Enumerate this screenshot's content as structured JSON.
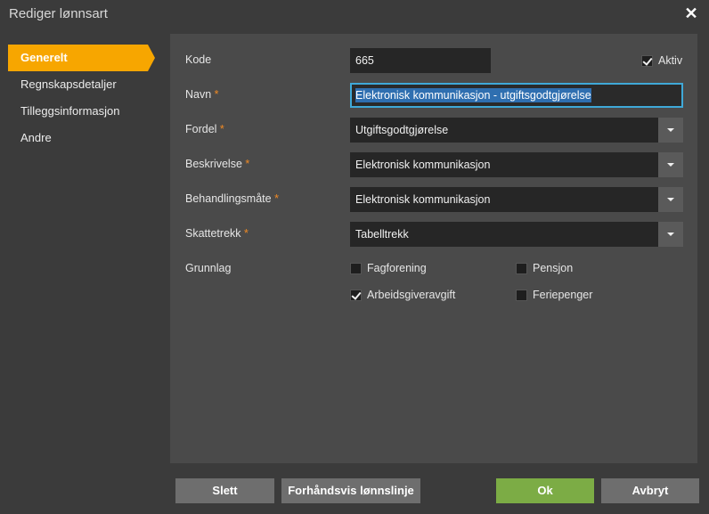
{
  "window": {
    "title": "Rediger lønnsart",
    "close_glyph": "✕"
  },
  "sidebar": {
    "items": [
      {
        "label": "Generelt",
        "active": true
      },
      {
        "label": "Regnskapsdetaljer",
        "active": false
      },
      {
        "label": "Tilleggsinformasjon",
        "active": false
      },
      {
        "label": "Andre",
        "active": false
      }
    ]
  },
  "form": {
    "kode": {
      "label": "Kode",
      "value": "665"
    },
    "aktiv": {
      "label": "Aktiv",
      "checked": true
    },
    "navn": {
      "label": "Navn",
      "required": "*",
      "value": "Elektronisk kommunikasjon - utgiftsgodtgjørelse"
    },
    "fordel": {
      "label": "Fordel",
      "required": "*",
      "value": "Utgiftsgodtgjørelse"
    },
    "beskrivelse": {
      "label": "Beskrivelse",
      "required": "*",
      "value": "Elektronisk kommunikasjon"
    },
    "behandlingsmate": {
      "label": "Behandlingsmåte",
      "required": "*",
      "value": "Elektronisk kommunikasjon"
    },
    "skattetrekk": {
      "label": "Skattetrekk",
      "required": "*",
      "value": "Tabelltrekk"
    },
    "grunnlag": {
      "label": "Grunnlag",
      "options": [
        {
          "label": "Fagforening",
          "checked": false
        },
        {
          "label": "Pensjon",
          "checked": false
        },
        {
          "label": "Arbeidsgiveravgift",
          "checked": true
        },
        {
          "label": "Feriepenger",
          "checked": false
        }
      ]
    }
  },
  "footer": {
    "delete_label": "Slett",
    "preview_label": "Forhåndsvis lønnslinje",
    "ok_label": "Ok",
    "cancel_label": "Avbryt"
  },
  "colors": {
    "accent": "#f7a600",
    "ok": "#7cac45",
    "focus": "#3fa9d8",
    "required": "#f08a24"
  }
}
